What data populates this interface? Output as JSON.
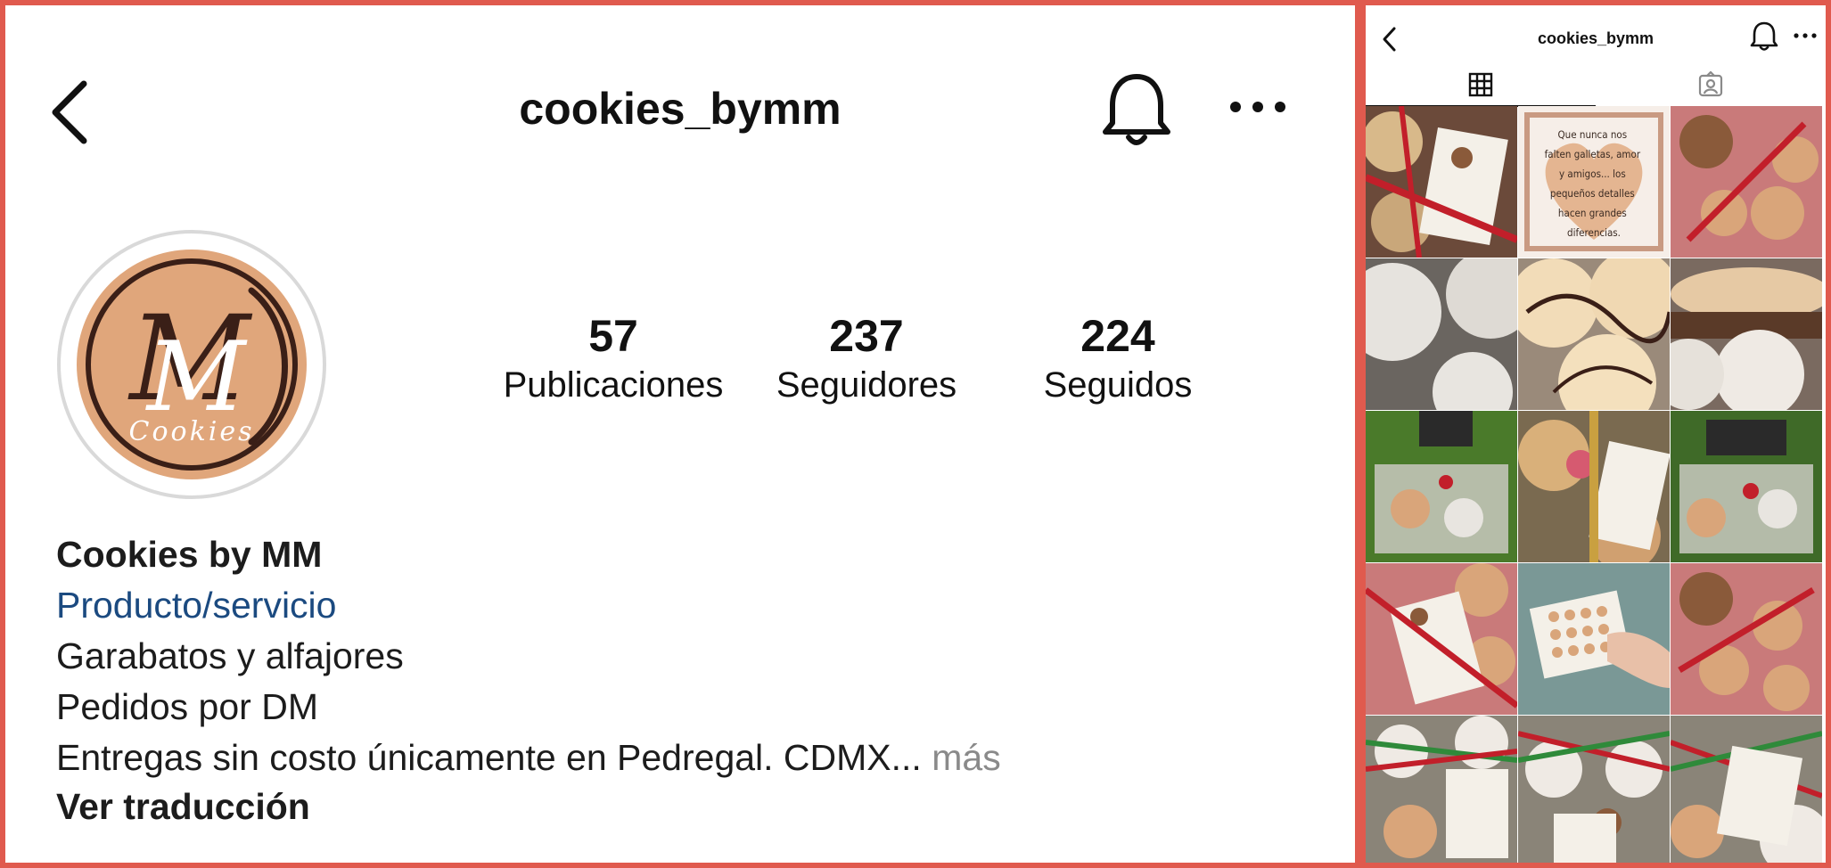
{
  "profile": {
    "username": "cookies_bymm",
    "display_name": "Cookies by MM",
    "category": "Producto/servicio",
    "bio_lines": [
      "Garabatos y alfajores",
      "Pedidos por DM",
      "Entregas sin costo únicamente en Pedregal. CDMX..."
    ],
    "more_label": "más",
    "translate_label": "Ver traducción",
    "avatar_text": "Cookies",
    "avatar_monogram": "M"
  },
  "stats": {
    "posts": {
      "value": "57",
      "label": "Publicaciones"
    },
    "followers": {
      "value": "237",
      "label": "Seguidores"
    },
    "following": {
      "value": "224",
      "label": "Seguidos"
    }
  },
  "quote_post": {
    "lines": [
      "Que nunca nos",
      "falten galletas, amor",
      "y amigos... los",
      "pequeños detalles",
      "hacen grandes",
      "diferencias."
    ]
  },
  "colors": {
    "frame": "#e05a4e",
    "avatar_bg": "#e0a67b",
    "category_link": "#1b4a80",
    "muted": "#8a8a8a"
  },
  "icons": {
    "back": "chevron-left-icon",
    "notifications": "bell-icon",
    "options": "more-horizontal-icon",
    "posts_tab": "grid-icon",
    "tagged_tab": "tagged-person-icon"
  }
}
